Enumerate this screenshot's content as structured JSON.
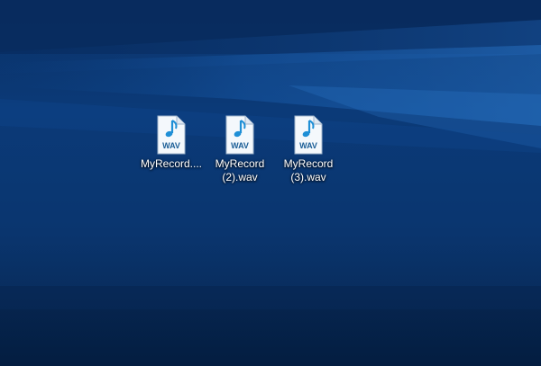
{
  "desktop": {
    "colors": {
      "wallpaper_dark": "#062450",
      "wallpaper_mid": "#0b3a78",
      "wallpaper_light": "#1a63b8",
      "label_text": "#ffffff",
      "file_accent": "#1f8fd6"
    },
    "icons": [
      {
        "name": "MyRecord....",
        "type_badge": "WAV",
        "glyph": "music-note-icon"
      },
      {
        "name": "MyRecord (2).wav",
        "type_badge": "WAV",
        "glyph": "music-note-icon"
      },
      {
        "name": "MyRecord (3).wav",
        "type_badge": "WAV",
        "glyph": "music-note-icon"
      }
    ]
  }
}
